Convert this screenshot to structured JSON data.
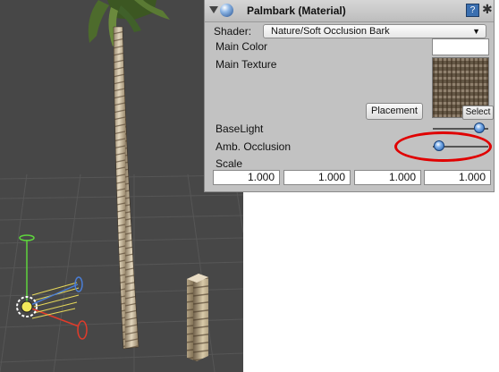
{
  "inspector": {
    "title": "Palmbark (Material)",
    "help_icon": "?",
    "shader_label": "Shader:",
    "shader_value": "Nature/Soft Occlusion Bark",
    "main_color_label": "Main Color",
    "main_color_value": "#ffffff",
    "main_texture_label": "Main Texture",
    "texture_select_label": "Select",
    "placement_label": "Placement",
    "baselight_label": "BaseLight",
    "baselight_value": 0.95,
    "amb_occlusion_label": "Amb. Occlusion",
    "amb_occlusion_value": 0.1,
    "scale_label": "Scale",
    "scale_values": [
      "1.000",
      "1.000",
      "1.000",
      "1.000"
    ]
  },
  "annotation": {
    "color": "#e00000"
  }
}
